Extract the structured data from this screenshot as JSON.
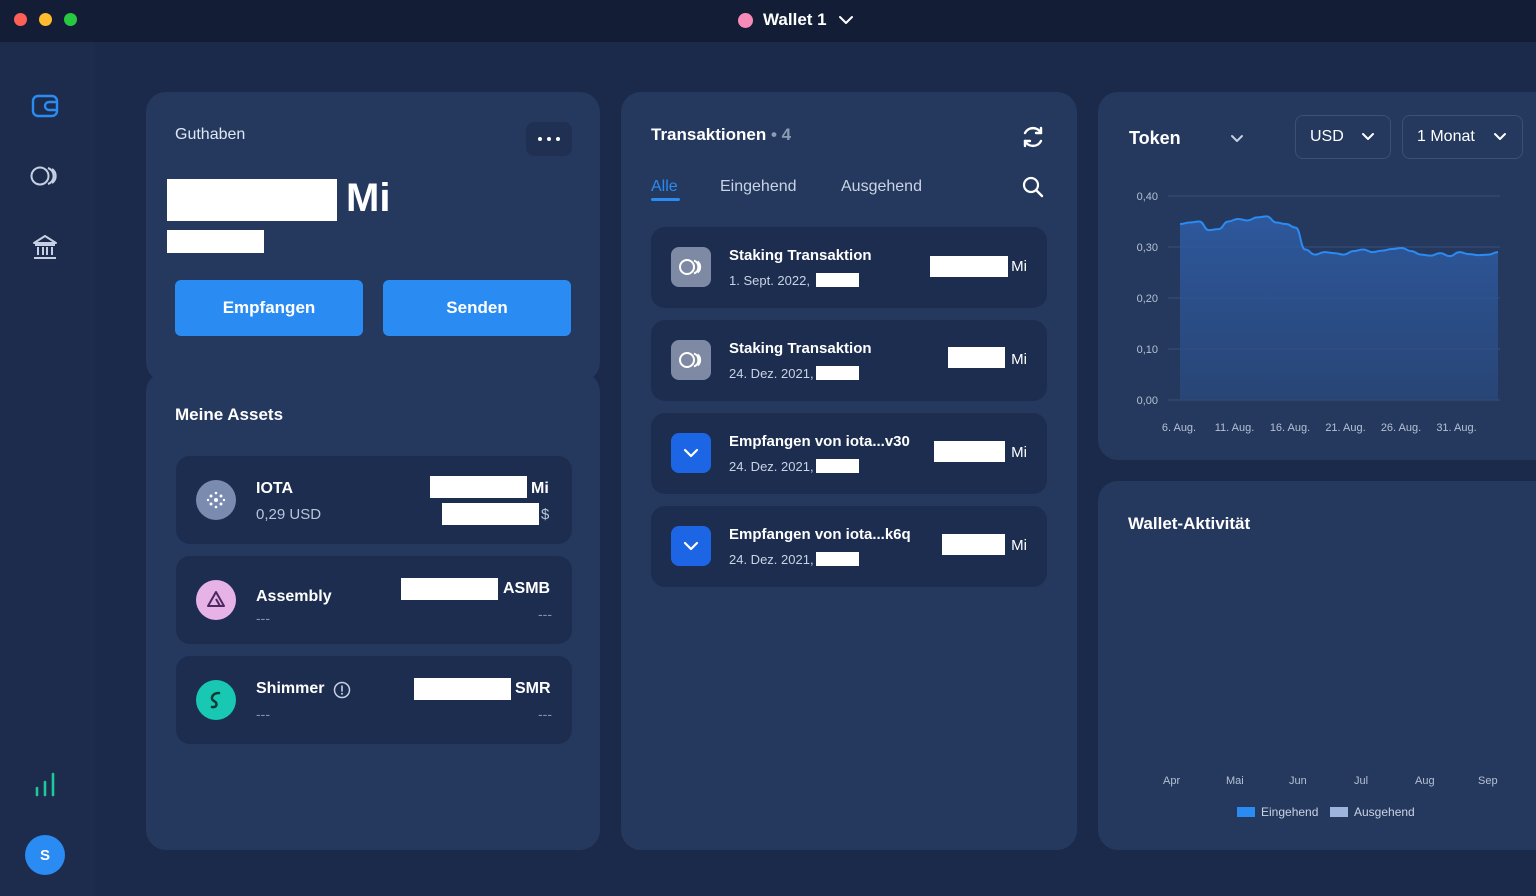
{
  "window": {
    "wallet_name": "Wallet 1",
    "wallet_color": "#f68ab8"
  },
  "sidebar": {
    "items": [
      {
        "name": "wallet",
        "icon": "wallet-icon"
      },
      {
        "name": "staking",
        "icon": "staking-icon"
      },
      {
        "name": "governance",
        "icon": "governance-icon"
      }
    ],
    "bottom": {
      "icon": "chart-bars-icon"
    },
    "avatar_initial": "S"
  },
  "balance": {
    "title": "Guthaben",
    "unit": "Mi",
    "receive_label": "Empfangen",
    "send_label": "Senden"
  },
  "assets": {
    "title": "Meine Assets",
    "items": [
      {
        "name": "IOTA",
        "price": "0,29 USD",
        "unit": "Mi",
        "fiat_unit": "$",
        "icon": "iota-icon",
        "icon_color": "#7b8bb0"
      },
      {
        "name": "Assembly",
        "price": "---",
        "unit": "ASMB",
        "fiat": "---",
        "icon": "assembly-icon",
        "icon_color": "#e7b3e6"
      },
      {
        "name": "Shimmer",
        "price": "---",
        "unit": "SMR",
        "fiat": "---",
        "icon": "shimmer-icon",
        "icon_color": "#18c8b3"
      }
    ]
  },
  "transactions": {
    "title": "Transaktionen",
    "count": "• 4",
    "tabs": [
      "Alle",
      "Eingehend",
      "Ausgehend"
    ],
    "items": [
      {
        "title": "Staking Transaktion",
        "date": "1. Sept. 2022,",
        "unit": "Mi",
        "type": "staking"
      },
      {
        "title": "Staking Transaktion",
        "date": "24. Dez. 2021,",
        "unit": "Mi",
        "type": "staking"
      },
      {
        "title": "Empfangen von iota...v30",
        "date": "24. Dez. 2021,",
        "unit": "Mi",
        "type": "incoming"
      },
      {
        "title": "Empfangen von iota...k6q",
        "date": "24. Dez. 2021,",
        "unit": "Mi",
        "type": "incoming"
      }
    ]
  },
  "token": {
    "title": "Token",
    "currency": "USD",
    "period": "1 Monat"
  },
  "activity": {
    "title": "Wallet-Aktivität",
    "months": [
      "Apr",
      "Mai",
      "Jun",
      "Jul",
      "Aug",
      "Sep"
    ],
    "legend": [
      "Eingehend",
      "Ausgehend"
    ],
    "legend_colors": [
      "#2a8bf2",
      "#9db4dc"
    ]
  },
  "chart_data": {
    "type": "area",
    "x_labels": [
      "6. Aug.",
      "11. Aug.",
      "16. Aug.",
      "21. Aug.",
      "26. Aug.",
      "31. Aug."
    ],
    "y_ticks": [
      "0,40",
      "0,30",
      "0,20",
      "0,10",
      "0,00"
    ],
    "ylim": [
      0,
      0.4
    ],
    "grid": true,
    "x": [
      1,
      2,
      3,
      4,
      5,
      6,
      7,
      8,
      9,
      10,
      11,
      12,
      13,
      14,
      15,
      16,
      17,
      18,
      19,
      20,
      21,
      22,
      23,
      24,
      25,
      26,
      27,
      28,
      29,
      30,
      31,
      32,
      33,
      34
    ],
    "values": [
      0.345,
      0.348,
      0.35,
      0.333,
      0.335,
      0.35,
      0.355,
      0.352,
      0.358,
      0.36,
      0.348,
      0.345,
      0.338,
      0.295,
      0.285,
      0.29,
      0.288,
      0.285,
      0.292,
      0.295,
      0.29,
      0.293,
      0.296,
      0.298,
      0.292,
      0.285,
      0.283,
      0.288,
      0.282,
      0.29,
      0.286,
      0.284,
      0.285,
      0.29
    ],
    "line_color": "#2a8bf2"
  }
}
